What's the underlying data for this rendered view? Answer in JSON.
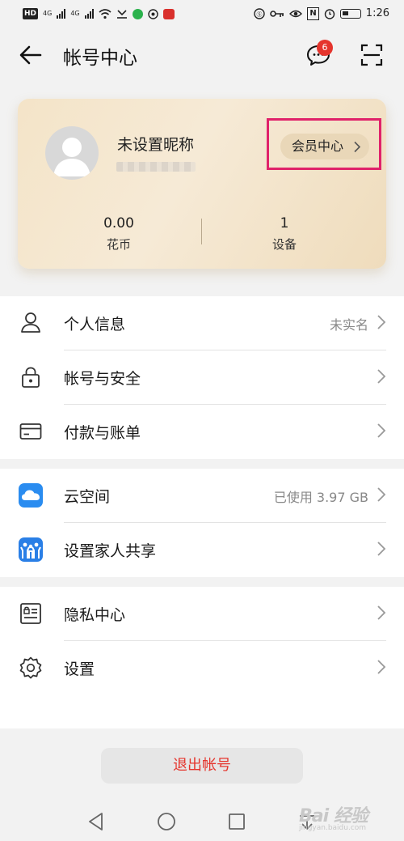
{
  "status_bar": {
    "hd": "HD",
    "net1": "4G",
    "net2": "4G",
    "time": "1:26",
    "nfc": "N"
  },
  "header": {
    "title": "帐号中心",
    "message_badge": "6"
  },
  "profile": {
    "nickname": "未设置昵称",
    "vip_label": "会员中心",
    "stats": [
      {
        "value": "0.00",
        "label": "花币"
      },
      {
        "value": "1",
        "label": "设备"
      }
    ]
  },
  "section1": [
    {
      "label": "个人信息",
      "value": "未实名",
      "icon": "person-icon"
    },
    {
      "label": "帐号与安全",
      "value": "",
      "icon": "lock-icon"
    },
    {
      "label": "付款与账单",
      "value": "",
      "icon": "card-icon"
    }
  ],
  "section2": [
    {
      "label": "云空间",
      "value": "已使用 3.97 GB",
      "icon": "cloud-app-icon"
    },
    {
      "label": "设置家人共享",
      "value": "",
      "icon": "family-app-icon"
    }
  ],
  "section3": [
    {
      "label": "隐私中心",
      "value": "",
      "icon": "privacy-icon"
    },
    {
      "label": "设置",
      "value": "",
      "icon": "gear-icon"
    }
  ],
  "logout_label": "退出帐号",
  "watermark": {
    "brand": "Bai 经验",
    "url": "jingyan.baidu.com"
  },
  "colors": {
    "accent_red": "#e5352d",
    "highlight_box": "#e0226a",
    "card_gold": "#f4e4c8"
  }
}
